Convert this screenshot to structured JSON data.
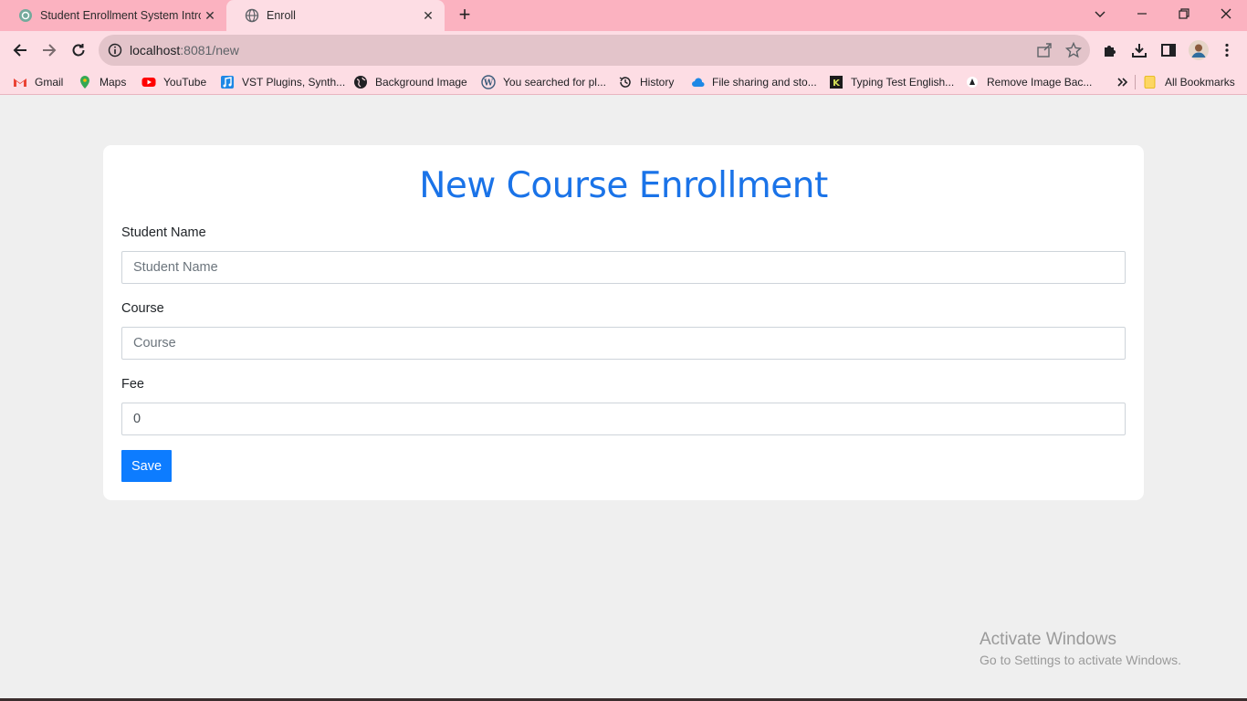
{
  "browser": {
    "tabs": [
      {
        "title": "Student Enrollment System Introduction",
        "icon": "chatgpt-icon",
        "active": false
      },
      {
        "title": "Enroll",
        "icon": "globe-icon",
        "active": true
      }
    ],
    "url_host": "localhost",
    "url_path": ":8081/new",
    "bookmarks": [
      {
        "label": "Gmail",
        "icon": "gmail-icon"
      },
      {
        "label": "Maps",
        "icon": "maps-pin-icon"
      },
      {
        "label": "YouTube",
        "icon": "youtube-icon"
      },
      {
        "label": "VST Plugins, Synth...",
        "icon": "music-note-icon"
      },
      {
        "label": "Background Image",
        "icon": "globe-dark-icon"
      },
      {
        "label": "You searched for pl...",
        "icon": "wordpress-icon"
      },
      {
        "label": "History",
        "icon": "history-icon"
      },
      {
        "label": "File sharing and sto...",
        "icon": "cloud-icon"
      },
      {
        "label": "Typing Test English...",
        "icon": "typing-icon"
      },
      {
        "label": "Remove Image Bac...",
        "icon": "remove-bg-icon"
      }
    ],
    "all_bookmarks_label": "All Bookmarks"
  },
  "page": {
    "title": "New Course Enrollment",
    "fields": {
      "student_name": {
        "label": "Student Name",
        "placeholder": "Student Name",
        "value": ""
      },
      "course": {
        "label": "Course",
        "placeholder": "Course",
        "value": ""
      },
      "fee": {
        "label": "Fee",
        "placeholder": "",
        "value": "0"
      }
    },
    "save_label": "Save"
  },
  "watermark": {
    "title": "Activate Windows",
    "subtitle": "Go to Settings to activate Windows."
  },
  "colors": {
    "tabstrip": "#fbb2c0",
    "toolbar": "#fddde4",
    "accent": "#1a73e8",
    "button": "#0d7cff"
  }
}
